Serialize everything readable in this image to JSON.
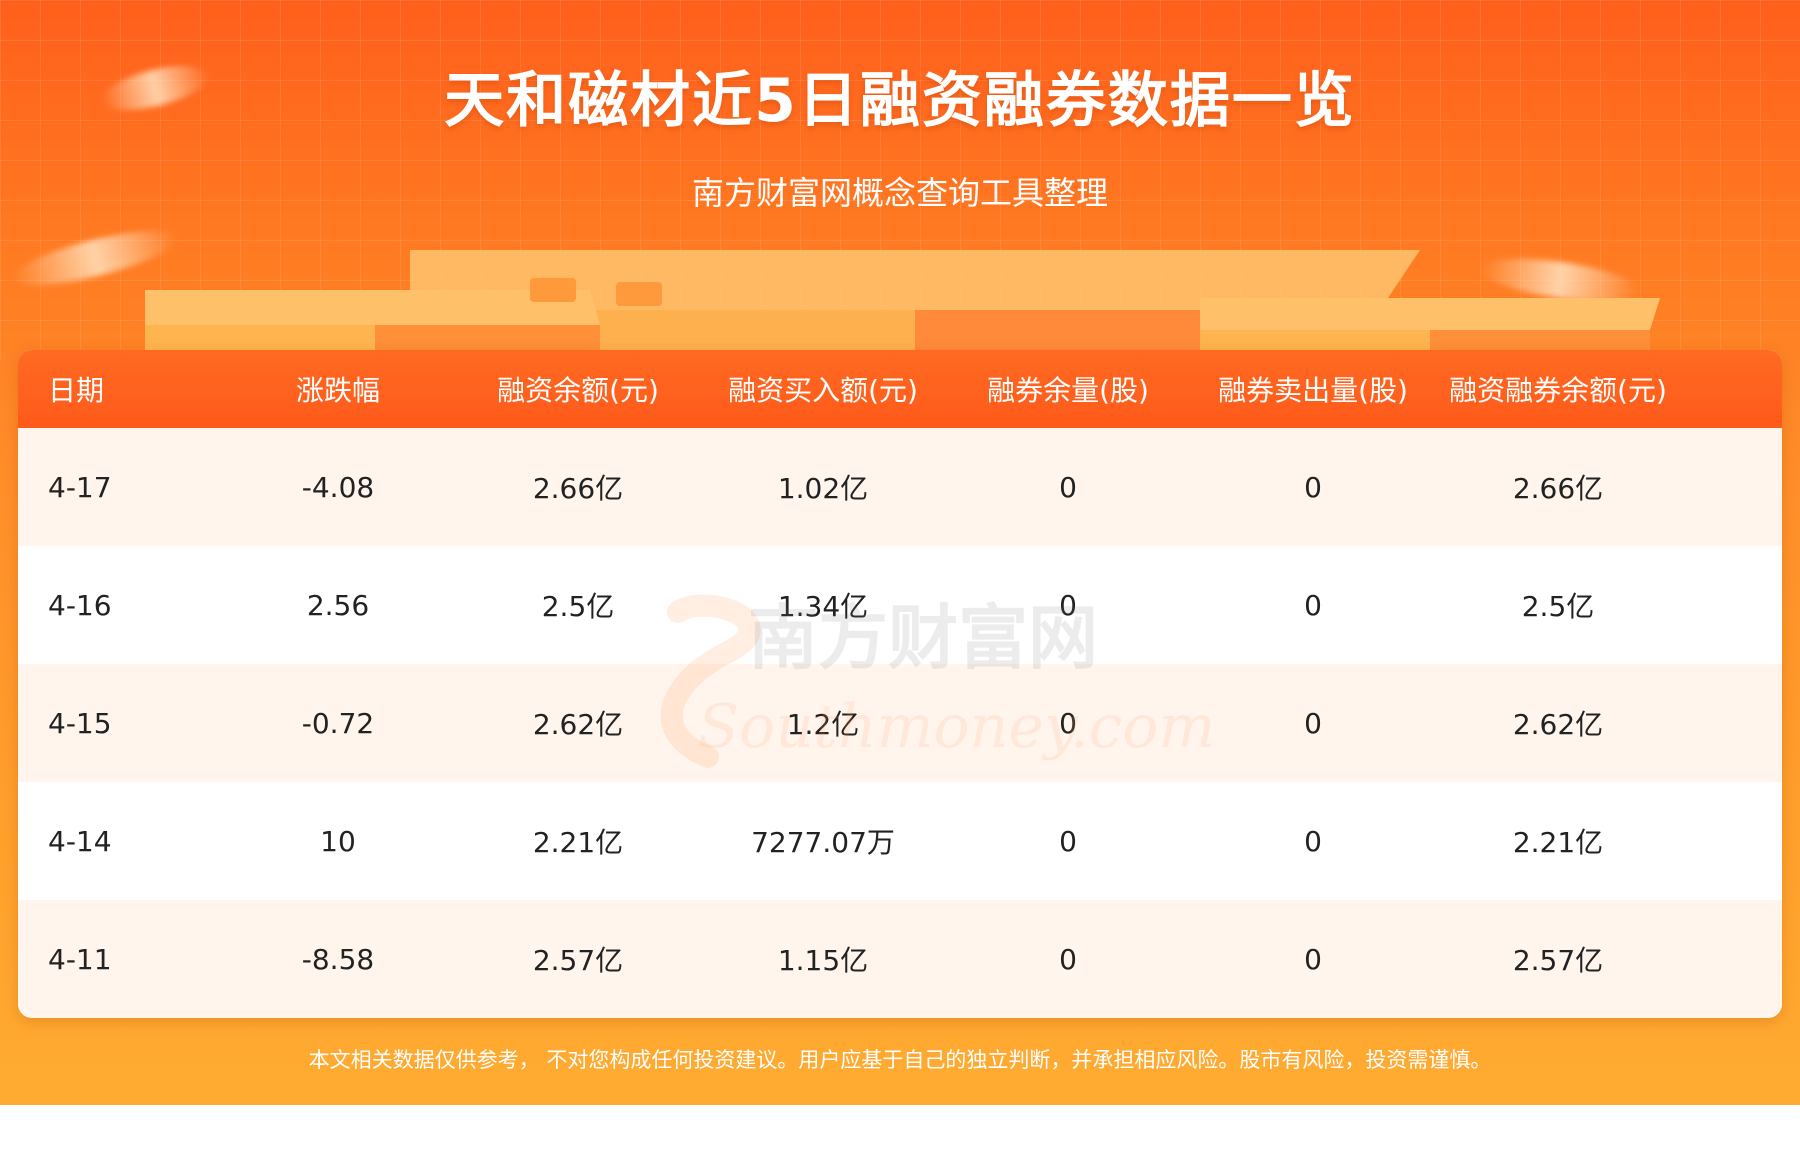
{
  "header": {
    "title": "天和磁材近5日融资融券数据一览",
    "subtitle": "南方财富网概念查询工具整理"
  },
  "table": {
    "columns": [
      "日期",
      "涨跌幅",
      "融资余额(元)",
      "融资买入额(元)",
      "融券余量(股)",
      "融券卖出量(股)",
      "融资融券余额(元)"
    ],
    "rows": [
      [
        "4-17",
        "-4.08",
        "2.66亿",
        "1.02亿",
        "0",
        "0",
        "2.66亿"
      ],
      [
        "4-16",
        "2.56",
        "2.5亿",
        "1.34亿",
        "0",
        "0",
        "2.5亿"
      ],
      [
        "4-15",
        "-0.72",
        "2.62亿",
        "1.2亿",
        "0",
        "0",
        "2.62亿"
      ],
      [
        "4-14",
        "10",
        "2.21亿",
        "7277.07万",
        "0",
        "0",
        "2.21亿"
      ],
      [
        "4-11",
        "-8.58",
        "2.57亿",
        "1.15亿",
        "0",
        "0",
        "2.57亿"
      ]
    ]
  },
  "watermark": {
    "cn": "南方财富网",
    "en": "Southmoney.com"
  },
  "footer": {
    "disclaimer": "本文相关数据仅供参考， 不对您构成任何投资建议。用户应基于自己的独立判断，并承担相应风险。股市有风险，投资需谨慎。"
  },
  "colors": {
    "header_orange": "#ff5f1c",
    "table_header": "#ff6a22",
    "row_alt": "#fff5ed"
  }
}
